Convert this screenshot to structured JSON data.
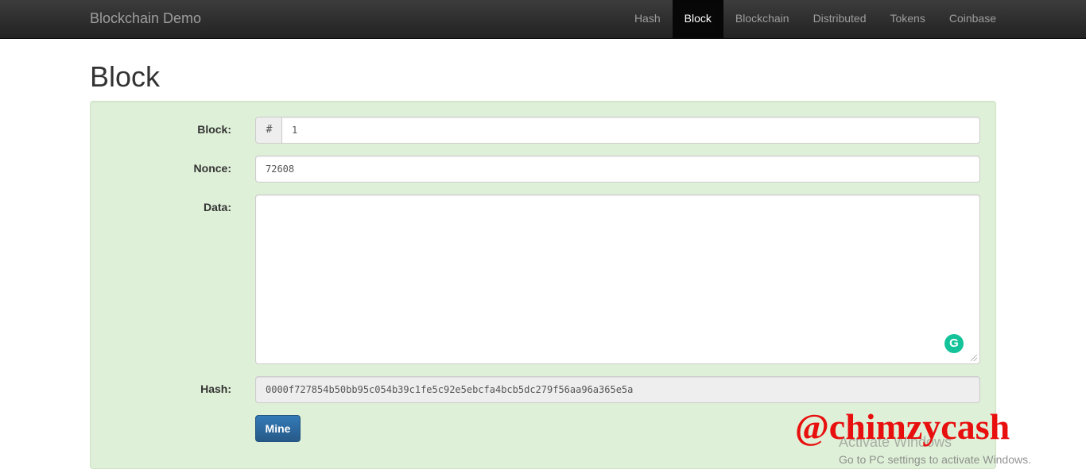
{
  "navbar": {
    "brand": "Blockchain Demo",
    "items": [
      {
        "label": "Hash",
        "active": false
      },
      {
        "label": "Block",
        "active": true
      },
      {
        "label": "Blockchain",
        "active": false
      },
      {
        "label": "Distributed",
        "active": false
      },
      {
        "label": "Tokens",
        "active": false
      },
      {
        "label": "Coinbase",
        "active": false
      }
    ]
  },
  "page": {
    "title": "Block"
  },
  "form": {
    "block_label": "Block:",
    "block_prefix": "#",
    "block_value": "1",
    "nonce_label": "Nonce:",
    "nonce_value": "72608",
    "data_label": "Data:",
    "data_value": "",
    "hash_label": "Hash:",
    "hash_value": "0000f727854b50bb95c054b39c1fe5c92e5ebcfa4bcb5dc279f56aa96a365e5a",
    "mine_label": "Mine"
  },
  "overlay": {
    "watermark": "@chimzycash",
    "activate_title": "Activate Windows",
    "activate_subtitle": "Go to PC settings to activate Windows.",
    "grammarly_icon": "grammarly-icon"
  },
  "colors": {
    "well_bg": "#dff0d8",
    "button_primary": "#337ab7",
    "watermark": "#e8100f",
    "grammarly": "#15c39a"
  }
}
